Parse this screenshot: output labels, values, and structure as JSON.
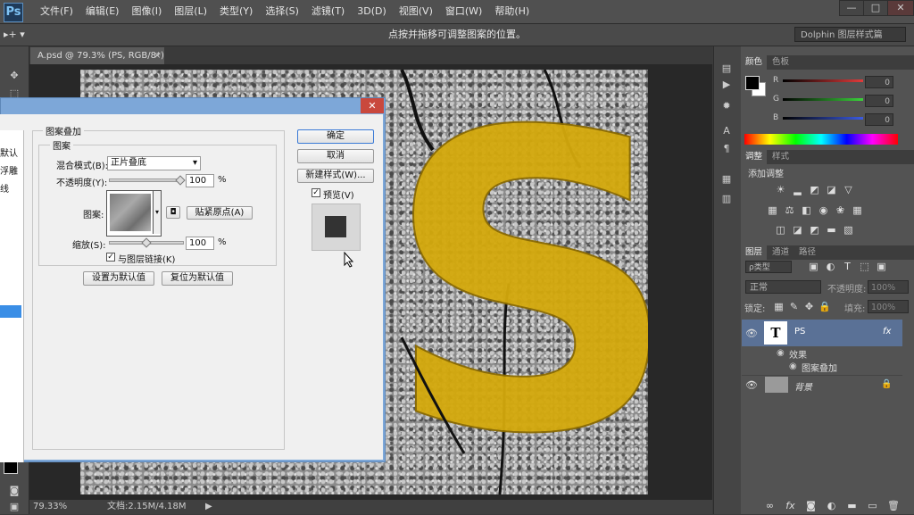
{
  "app": {
    "logo": "Ps"
  },
  "menu": [
    "文件(F)",
    "编辑(E)",
    "图像(I)",
    "图层(L)",
    "类型(Y)",
    "选择(S)",
    "滤镜(T)",
    "3D(D)",
    "视图(V)",
    "窗口(W)",
    "帮助(H)"
  ],
  "window_controls": {
    "minimize": "—",
    "restore": "□",
    "close": "✕"
  },
  "options_bar": {
    "tool_preset": "▸+ ▾",
    "hint": "点按并拖移可调整图案的位置。",
    "workspace": "Dolphin 图层样式篇"
  },
  "document": {
    "tab_label": "A.psd @ 79.3% (PS, RGB/8*) *",
    "tab_close": "×",
    "zoom": "79.33%",
    "doc_size": "文档:2.15M/4.18M"
  },
  "canvas_art": {
    "letter": "S",
    "letter_color": "#d4a90c"
  },
  "dialog": {
    "close": "✕",
    "left_partial": [
      "默认",
      "浮雕",
      "线"
    ],
    "section_title": "图案叠加",
    "group_title": "图案",
    "blend_mode_label": "混合模式(B):",
    "blend_mode_value": "正片叠底",
    "opacity_label": "不透明度(Y):",
    "opacity_value": "100",
    "opacity_unit": "%",
    "opacity_level": 1.0,
    "pattern_label": "图案:",
    "snap_button": "贴紧原点(A)",
    "scale_label": "缩放(S):",
    "scale_value": "100",
    "scale_unit": "%",
    "scale_level": 0.5,
    "link_label": "与图层链接(K)",
    "link_checked": true,
    "set_default_button": "设置为默认值",
    "reset_default_button": "复位为默认值",
    "ok_button": "确定",
    "cancel_button": "取消",
    "new_style_button": "新建样式(W)...",
    "preview_label": "预览(V)",
    "preview_checked": true
  },
  "color_panel": {
    "tabs": [
      "颜色",
      "色板"
    ],
    "channels": [
      {
        "label": "R",
        "value": "0",
        "color": "#e23b3b"
      },
      {
        "label": "G",
        "value": "0",
        "color": "#3bd23b"
      },
      {
        "label": "B",
        "value": "0",
        "color": "#3b5be2"
      }
    ]
  },
  "adjust_panel": {
    "tabs": [
      "调整",
      "样式"
    ],
    "title": "添加调整"
  },
  "layers_panel": {
    "tabs": [
      "图层",
      "通道",
      "路径"
    ],
    "filter_label": "ρ类型",
    "blend_mode": "正常",
    "opacity_label": "不透明度:",
    "opacity_value": "100%",
    "lock_label": "锁定:",
    "fill_label": "填充:",
    "fill_value": "100%",
    "layers": [
      {
        "name": "PS",
        "thumb": "T",
        "fx": "fx"
      },
      {
        "name": "效果"
      },
      {
        "name": "图案叠加"
      },
      {
        "name": "背景"
      }
    ]
  }
}
